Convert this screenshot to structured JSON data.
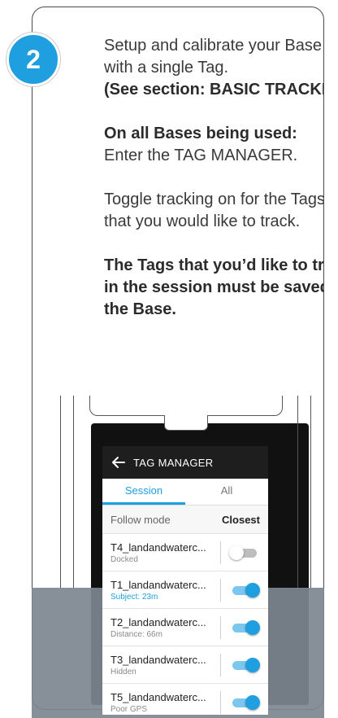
{
  "step": {
    "number": "2"
  },
  "instructions": {
    "line1": "Setup and calibrate your Base",
    "line2": "with a single Tag.",
    "see_section": "(See section: BASIC TRACKING)",
    "bases_heading": "On all Bases being used:",
    "enter_manager": "Enter the TAG MANAGER.",
    "toggle_line1": "Toggle tracking on for the Tags",
    "toggle_line2": "that you would like to track.",
    "note_line1": "The Tags that you’d like to track",
    "note_line2": "in the session must be saved to",
    "note_line3": "the Base."
  },
  "app": {
    "title": "TAG MANAGER",
    "back_icon": "arrow-left-icon",
    "tabs": [
      {
        "label": "Session",
        "active": true
      },
      {
        "label": "All",
        "active": false
      }
    ],
    "follow_mode": {
      "label": "Follow mode",
      "value": "Closest"
    },
    "tags": [
      {
        "name": "T4_landandwaterc...",
        "status": "Docked",
        "tracking": false,
        "accent": false
      },
      {
        "name": "T1_landandwaterc...",
        "status": "Subject: 23m",
        "tracking": true,
        "accent": true
      },
      {
        "name": "T2_landandwaterc...",
        "status": "Distance: 66m",
        "tracking": true,
        "accent": false
      },
      {
        "name": "T3_landandwaterc...",
        "status": "Hidden",
        "tracking": true,
        "accent": false
      },
      {
        "name": "T5_landandwaterc...",
        "status": "Poor GPS",
        "tracking": true,
        "accent": false
      }
    ]
  },
  "colors": {
    "accent": "#1f9ee0",
    "tray": "#7d868f",
    "screen_bar": "#1e1e1e"
  }
}
